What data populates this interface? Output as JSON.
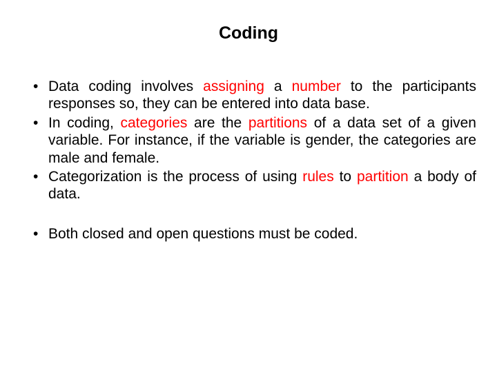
{
  "title": "Coding",
  "bullets_a": [
    {
      "pre": "Data coding involves ",
      "hl1": "assigning",
      "mid1": " a ",
      "hl2": "number",
      "post": " to the participants responses so, they can be entered into data base."
    },
    {
      "pre": "In coding, ",
      "hl1": "categories",
      "mid1": " are the ",
      "hl2": "partitions",
      "post": " of a data set of a given variable. For instance, if the variable is gender, the categories are male and female."
    },
    {
      "pre": "Categorization is the process of using ",
      "hl1": "rules",
      "mid1": " to ",
      "hl2": "partition",
      "post": " a body of data."
    }
  ],
  "bullets_b": [
    {
      "text": "Both closed and open questions must be coded."
    }
  ]
}
